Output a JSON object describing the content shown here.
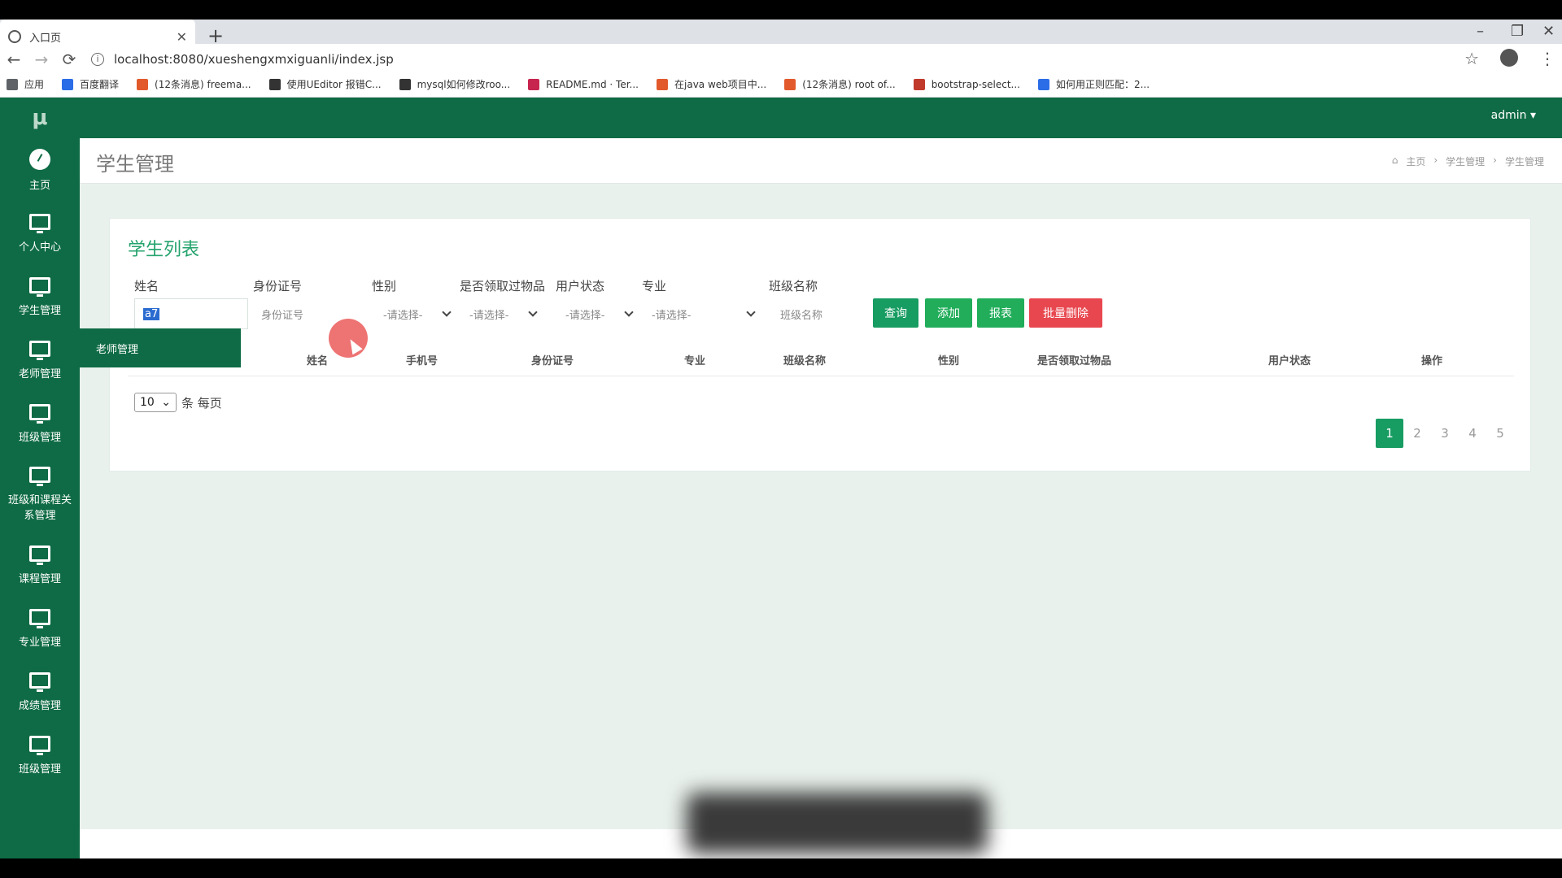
{
  "browser": {
    "tab_title": "入口页",
    "url": "localhost:8080/xueshengxmxiguanli/index.jsp",
    "bookmarks": [
      {
        "label": "应用",
        "color": "#5f6368"
      },
      {
        "label": "百度翻译",
        "color": "#2b6de6"
      },
      {
        "label": "(12条消息) freema...",
        "color": "#e25a2c"
      },
      {
        "label": "使用UEditor 报错C...",
        "color": "#333333"
      },
      {
        "label": "mysql如何修改roo...",
        "color": "#333333"
      },
      {
        "label": "README.md · Ter...",
        "color": "#c7254e"
      },
      {
        "label": "在java web项目中...",
        "color": "#e25a2c"
      },
      {
        "label": "(12条消息) root of...",
        "color": "#e25a2c"
      },
      {
        "label": "bootstrap-select...",
        "color": "#c0392b"
      },
      {
        "label": "如何用正则匹配：2...",
        "color": "#2b6de6"
      }
    ]
  },
  "app": {
    "logo": "μ",
    "user": "admin",
    "page_title": "学生管理",
    "breadcrumb": [
      "主页",
      "学生管理",
      "学生管理"
    ],
    "sidebar": [
      {
        "label": "主页",
        "icon": "dashboard-icon"
      },
      {
        "label": "个人中心",
        "icon": "monitor-icon"
      },
      {
        "label": "学生管理",
        "icon": "monitor-icon"
      },
      {
        "label": "老师管理",
        "icon": "monitor-icon"
      },
      {
        "label": "班级管理",
        "icon": "monitor-icon"
      },
      {
        "label": "班级和课程关系管理",
        "icon": "monitor-icon"
      },
      {
        "label": "课程管理",
        "icon": "monitor-icon"
      },
      {
        "label": "专业管理",
        "icon": "monitor-icon"
      },
      {
        "label": "成绩管理",
        "icon": "monitor-icon"
      },
      {
        "label": "班级管理",
        "icon": "monitor-icon"
      }
    ],
    "tooltip": "老师管理",
    "card_title": "学生列表",
    "filters": {
      "name_label": "姓名",
      "name_value": "a7",
      "id_label": "身份证号",
      "id_placeholder": "身份证号",
      "gender_label": "性别",
      "gender_value": "-请选择-",
      "received_label": "是否领取过物品",
      "received_value": "-请选择-",
      "status_label": "用户状态",
      "status_value": "-请选择-",
      "major_label": "专业",
      "major_value": "-请选择-",
      "class_label": "班级名称",
      "class_placeholder": "班级名称"
    },
    "buttons": {
      "query": "查询",
      "add": "添加",
      "report": "报表",
      "batch_delete": "批量删除"
    },
    "table_headers": [
      "姓名",
      "手机号",
      "身份证号",
      "专业",
      "班级名称",
      "性别",
      "是否领取过物品",
      "用户状态",
      "操作"
    ],
    "pagesize": {
      "value": "10",
      "suffix": "条 每页"
    },
    "pages": [
      "1",
      "2",
      "3",
      "4",
      "5"
    ],
    "colors": {
      "brand": "#0e6b45",
      "accent": "#24a36d",
      "danger": "#e8474f"
    }
  }
}
